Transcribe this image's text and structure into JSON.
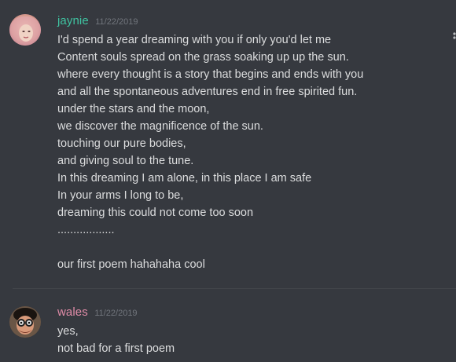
{
  "messages": [
    {
      "username": "jaynie",
      "timestamp": "11/22/2019",
      "lines": [
        "I'd spend a year dreaming with you if only you'd let me",
        "Content souls spread on the grass soaking up up the sun.",
        "where every thought is a story that begins and ends with you",
        "and all the spontaneous adventures end in free spirited fun.",
        "under the stars and the moon,",
        "we discover the magnificence of the sun.",
        "touching our pure bodies,",
        "and giving soul to the tune.",
        "In this dreaming I am alone, in this place I am safe",
        "In your arms I long to be,",
        "dreaming this could not come too soon",
        "..................",
        "",
        "our first poem hahahaha cool"
      ]
    },
    {
      "username": "wales",
      "timestamp": "11/22/2019",
      "lines": [
        "yes,",
        "not bad for a first poem"
      ]
    }
  ],
  "icons": {
    "more": "more-options-icon"
  },
  "colors": {
    "background": "#36393f",
    "text": "#dcddde",
    "timestamp": "#72767d",
    "username_jaynie": "#3fc3a1",
    "username_wales": "#e08ca8"
  }
}
